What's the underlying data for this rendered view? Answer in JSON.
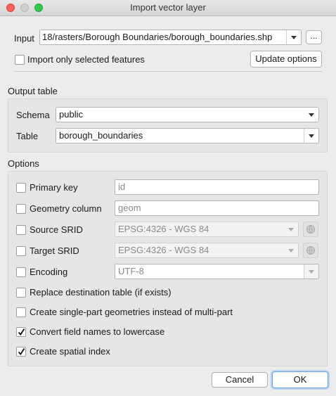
{
  "window": {
    "title": "Import vector layer"
  },
  "input": {
    "label": "Input",
    "value": "18/rasters/Borough Boundaries/borough_boundaries.shp",
    "browse_label": "...",
    "only_selected_label": "Import only selected features",
    "only_selected_checked": false,
    "update_options_label": "Update options"
  },
  "output_table": {
    "title": "Output table",
    "schema_label": "Schema",
    "schema_value": "public",
    "table_label": "Table",
    "table_value": "borough_boundaries"
  },
  "options": {
    "title": "Options",
    "primary_key_label": "Primary key",
    "primary_key_value": "id",
    "geometry_column_label": "Geometry column",
    "geometry_column_value": "geom",
    "source_srid_label": "Source SRID",
    "source_srid_value": "EPSG:4326 - WGS 84",
    "target_srid_label": "Target SRID",
    "target_srid_value": "EPSG:4326 - WGS 84",
    "encoding_label": "Encoding",
    "encoding_value": "UTF-8",
    "replace_label": "Replace destination table (if exists)",
    "replace_checked": false,
    "single_part_label": "Create single-part geometries instead of multi-part",
    "single_part_checked": false,
    "lowercase_label": "Convert field names to lowercase",
    "lowercase_checked": true,
    "spatial_index_label": "Create spatial index",
    "spatial_index_checked": true
  },
  "buttons": {
    "cancel": "Cancel",
    "ok": "OK"
  },
  "colors": {
    "ok_border": "#6aa0e6",
    "close": "#fc605c",
    "maximize": "#34c84a"
  }
}
